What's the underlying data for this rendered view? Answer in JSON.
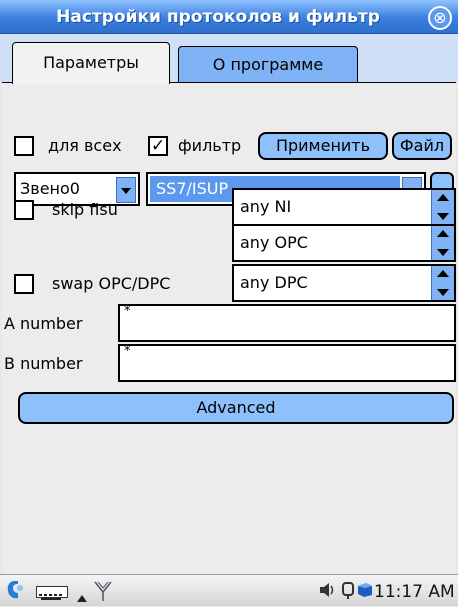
{
  "window": {
    "title": "Настройки протоколов и фильтр",
    "close_glyph": "⊗"
  },
  "tabs": [
    {
      "label": "Параметры",
      "active": true
    },
    {
      "label": "О программе",
      "active": false
    }
  ],
  "row1": {
    "for_all_label": "для всех",
    "for_all_checked": false,
    "filter_label": "фильтр",
    "filter_checked": true,
    "apply_button": "Применить",
    "file_button": "Файл"
  },
  "row2": {
    "link_select": "Звено0",
    "protocol_select": "SS7/ISUP",
    "browse_button": "..."
  },
  "filters": {
    "skip_fisu_label": "skip fisu",
    "skip_fisu_checked": false,
    "swap_label": "swap OPC/DPC",
    "swap_checked": false,
    "ni_value": "any NI",
    "opc_value": "any OPC",
    "dpc_value": "any DPC"
  },
  "numbers": {
    "a_label": "A number",
    "a_value": "*",
    "b_label": "B number",
    "b_value": "*"
  },
  "advanced_button": "Advanced",
  "taskbar": {
    "clock": "11:17 AM",
    "icons": [
      "start-icon",
      "keyboard-icon",
      "up-arrow-icon",
      "network-antenna-icon",
      "speaker-icon",
      "connection-icon",
      "battery-icon"
    ]
  },
  "colors": {
    "accent": "#7fb3f5",
    "title_bar": "#3a7fe0",
    "selected_protocol_bg": "#5b98ee"
  }
}
